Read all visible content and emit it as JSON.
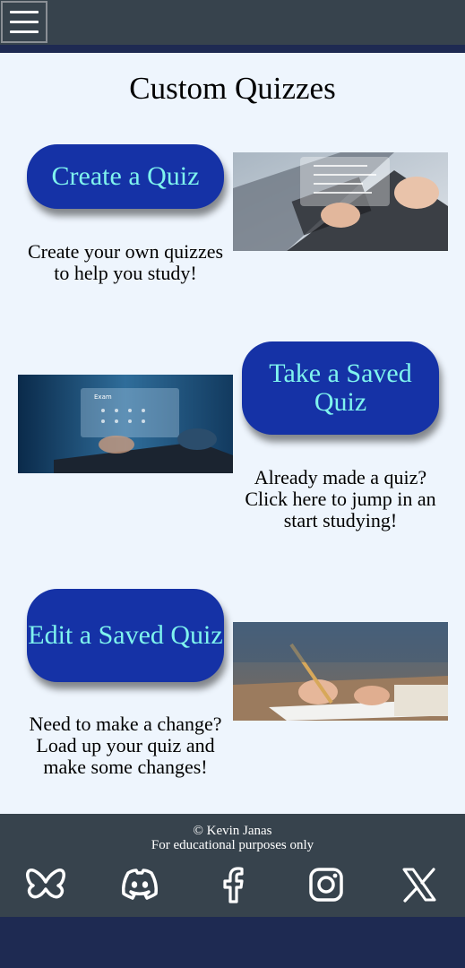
{
  "header": {
    "menu_icon": "hamburger-menu-icon"
  },
  "main": {
    "title": "Custom Quizzes",
    "cards": [
      {
        "button_label": "Create a Quiz",
        "description": "Create your own quizzes to help you study!",
        "image": "laptop-typing-photo"
      },
      {
        "button_label": "Take a Saved Quiz",
        "description": "Already made a quiz? Click here to jump in an start studying!",
        "image": "laptop-exam-photo"
      },
      {
        "button_label": "Edit a Saved Quiz",
        "description": "Need to make a change? Load up your quiz and make some changes!",
        "image": "writing-notes-photo"
      }
    ]
  },
  "footer": {
    "copyright": "© Kevin Janas",
    "note": "For educational purposes only",
    "social": [
      "bluesky-icon",
      "discord-icon",
      "facebook-icon",
      "instagram-icon",
      "x-icon"
    ]
  },
  "colors": {
    "header_bg": "#37434d",
    "accent_navy": "#1e2a52",
    "button_bg": "#1532a6",
    "button_text": "#7ff4ee",
    "main_bg": "#eef5fd"
  }
}
